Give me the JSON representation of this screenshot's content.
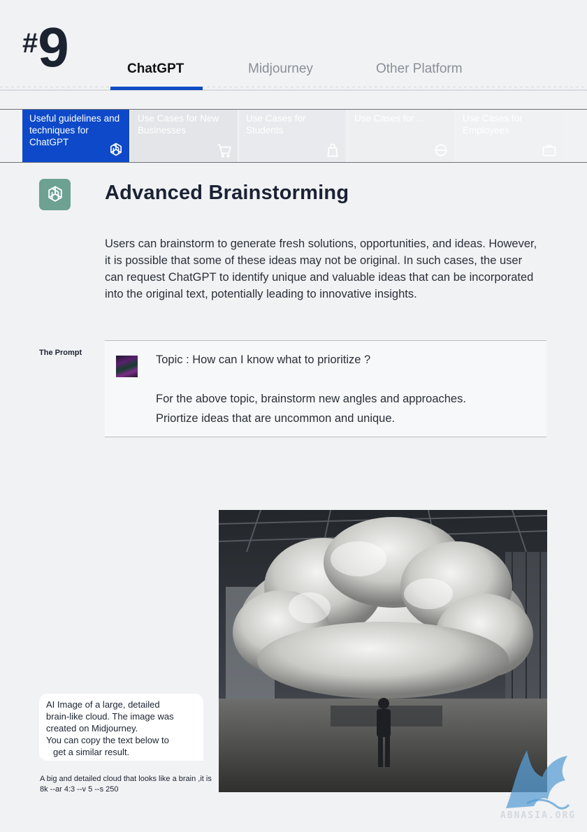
{
  "header": {
    "hash": "#",
    "number": "9",
    "tabs": [
      {
        "label": "ChatGPT",
        "active": true
      },
      {
        "label": "Midjourney",
        "active": false
      },
      {
        "label": "Other Platform",
        "active": false
      }
    ],
    "accent_color": "#0e4cc4"
  },
  "categories": [
    {
      "label": "Useful guidelines and techniques for ChatGPT",
      "icon": "chatgpt-icon",
      "active": true
    },
    {
      "label": "Use Cases for New Businesses",
      "icon": "cart-icon",
      "active": false
    },
    {
      "label": "Use Cases for Students",
      "icon": "bag-icon",
      "active": false
    },
    {
      "label": "Use Cases for ...",
      "icon": "box-icon",
      "active": false
    },
    {
      "label": "Use Cases for Employees",
      "icon": "briefcase-icon",
      "active": false
    }
  ],
  "section": {
    "title": "Advanced Brainstorming",
    "body": "Users can brainstorm to generate fresh solutions, opportunities, and ideas. However, it is possible that some of these ideas may not be original. In such cases, the user can request ChatGPT to identify unique and valuable ideas that can be incorporated into the original text, potentially leading to innovative insights."
  },
  "prompt": {
    "label": "The Prompt",
    "topic": "Topic : How can I know what to prioritize ?",
    "line1": "For the above topic, brainstorm new angles and approaches.",
    "line2": "Priortize ideas that are uncommon and unique."
  },
  "image_caption": {
    "line1": "AI Image of a large, detailed",
    "line2": "brain-like cloud. The image was",
    "line3": "created on Midjourney.",
    "line4": "You can copy the text below to",
    "line5": "get a similar result."
  },
  "midjourney_prompt": "A big and detailed cloud that looks like a brain ,it is 8k --ar 4:3 --v 5 --s 250",
  "watermark": "ABNASIA.ORG"
}
